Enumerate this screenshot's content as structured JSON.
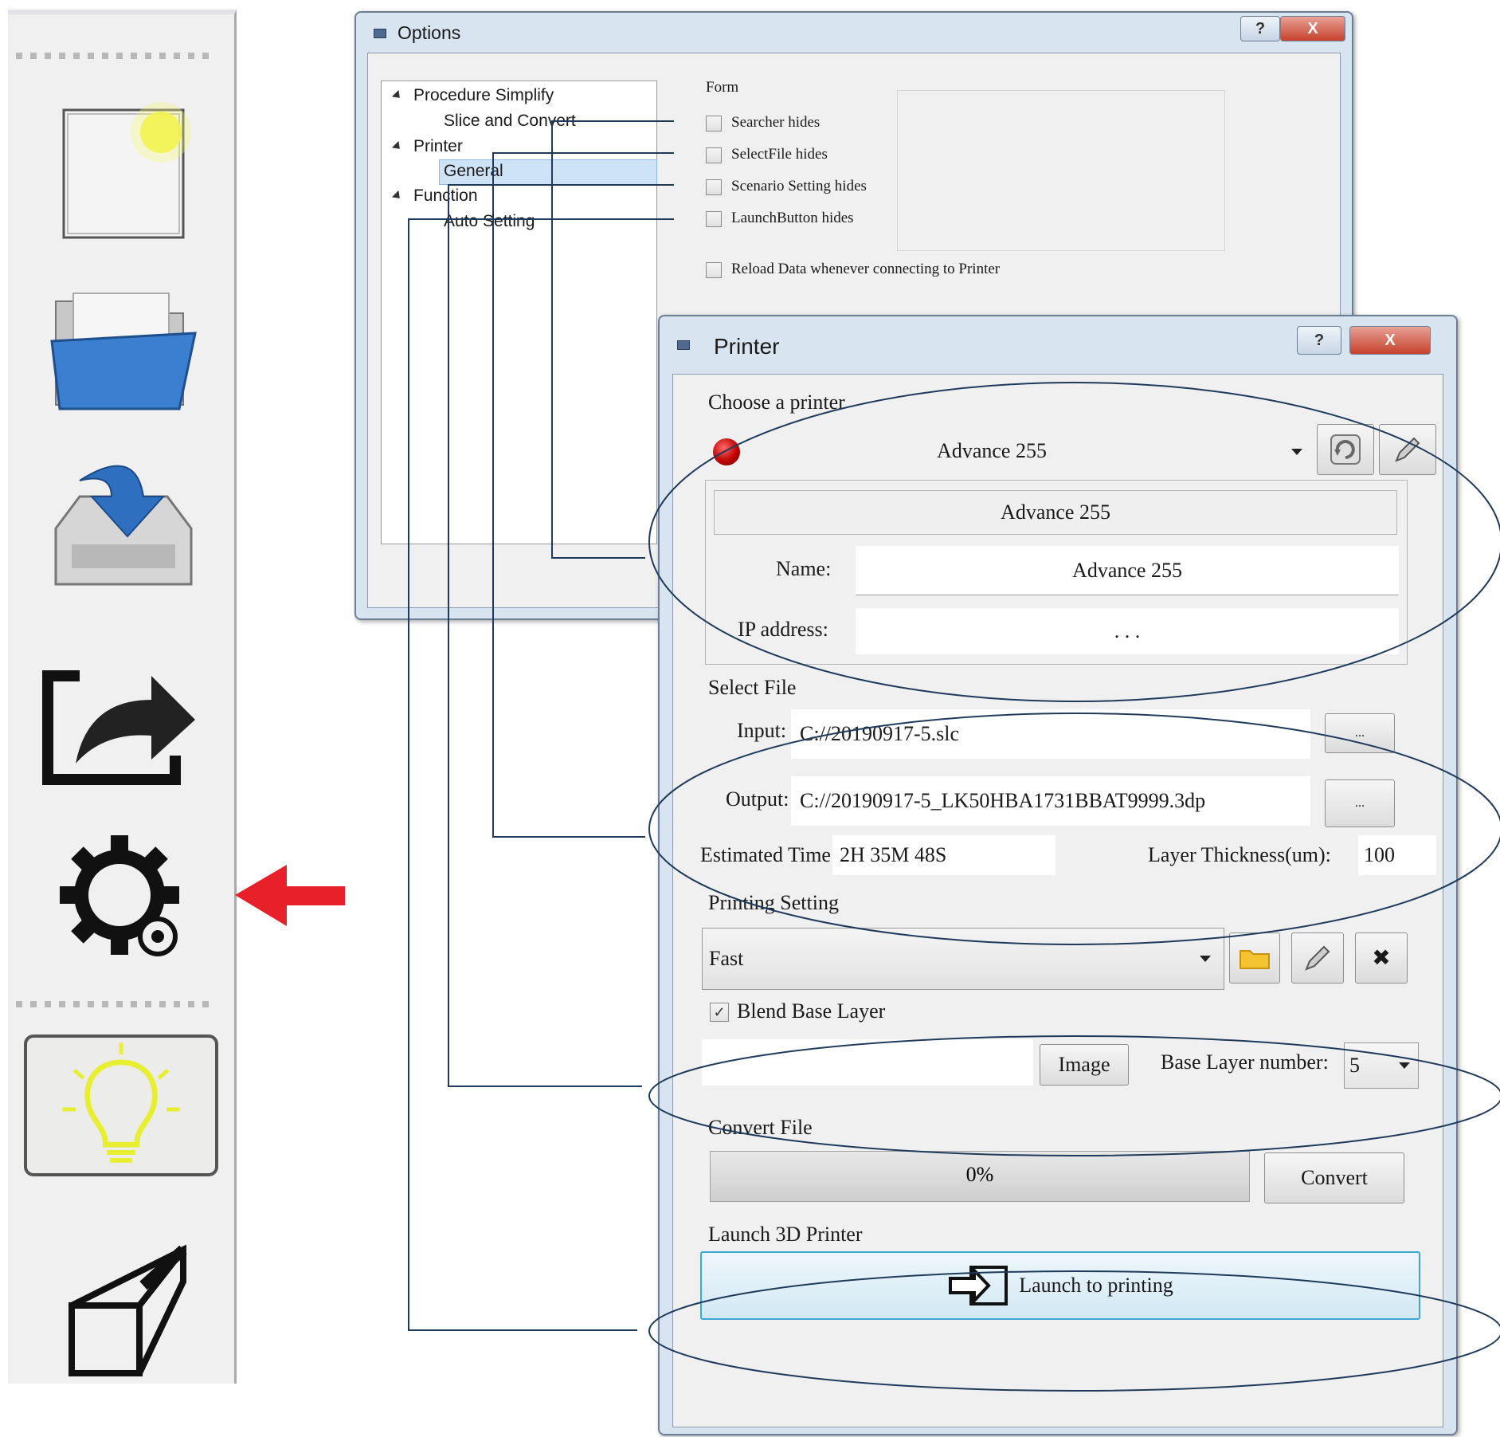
{
  "toolbar": {
    "items": [
      {
        "name": "new-project",
        "icon": "new-file-icon"
      },
      {
        "name": "open-file",
        "icon": "folder-icon"
      },
      {
        "name": "import",
        "icon": "import-tray-icon"
      },
      {
        "name": "export",
        "icon": "export-arrow-icon"
      },
      {
        "name": "options",
        "icon": "gear-icon"
      },
      {
        "name": "light",
        "icon": "lightbulb-icon"
      },
      {
        "name": "view",
        "icon": "cube-view-icon"
      }
    ],
    "pointer_color": "#e8202a"
  },
  "options_window": {
    "title": "Options",
    "help_glyph": "?",
    "close_glyph": "X",
    "tree": [
      {
        "label": "Procedure Simplify",
        "level": 0,
        "expanded": true
      },
      {
        "label": "Slice and Convert",
        "level": 1
      },
      {
        "label": "Printer",
        "level": 0,
        "expanded": true
      },
      {
        "label": "General",
        "level": 1,
        "selected": true
      },
      {
        "label": "Function",
        "level": 0,
        "expanded": true
      },
      {
        "label": "Auto Setting",
        "level": 1
      }
    ],
    "form_group_label": "Form",
    "checkboxes": [
      {
        "label": "Searcher hides",
        "checked": false
      },
      {
        "label": "SelectFile hides",
        "checked": false
      },
      {
        "label": "Scenario Setting hides",
        "checked": false
      },
      {
        "label": "LaunchButton hides",
        "checked": false
      }
    ],
    "reload_checkbox": {
      "label": "Reload Data whenever connecting to Printer",
      "checked": false
    }
  },
  "printer_window": {
    "title": "Printer",
    "help_glyph": "?",
    "close_glyph": "X",
    "choose_printer_label": "Choose a printer",
    "printer_selected": "Advance 255",
    "status_color": "#d40000",
    "printer_header": "Advance 255",
    "name_label": "Name:",
    "name_value": "Advance 255",
    "ip_label": "IP address:",
    "ip_value": ". . .",
    "select_file_label": "Select File",
    "input_label": "Input:",
    "input_value": "C://20190917-5.slc",
    "output_label": "Output:",
    "output_value": "C://20190917-5_LK50HBA1731BBAT9999.3dp",
    "browse_glyph": "...",
    "estimated_time_label": "Estimated Time:",
    "estimated_time_value": "2H 35M 48S",
    "layer_thickness_label": "Layer Thickness(um):",
    "layer_thickness_value": "100",
    "printing_setting_label": "Printing Setting",
    "printing_setting_value": "Fast",
    "delete_glyph": "✖",
    "blend_base_layer_label": "Blend Base Layer",
    "blend_base_layer_checked": true,
    "check_glyph": "✓",
    "image_button_label": "Image",
    "base_layer_number_label": "Base Layer number:",
    "base_layer_number_value": "5",
    "convert_file_label": "Convert File",
    "progress_text": "0%",
    "progress_value": 0,
    "convert_button_label": "Convert",
    "launch_section_label": "Launch 3D Printer",
    "launch_button_label": "Launch to printing"
  },
  "annotation_color": "#1f3a5a"
}
